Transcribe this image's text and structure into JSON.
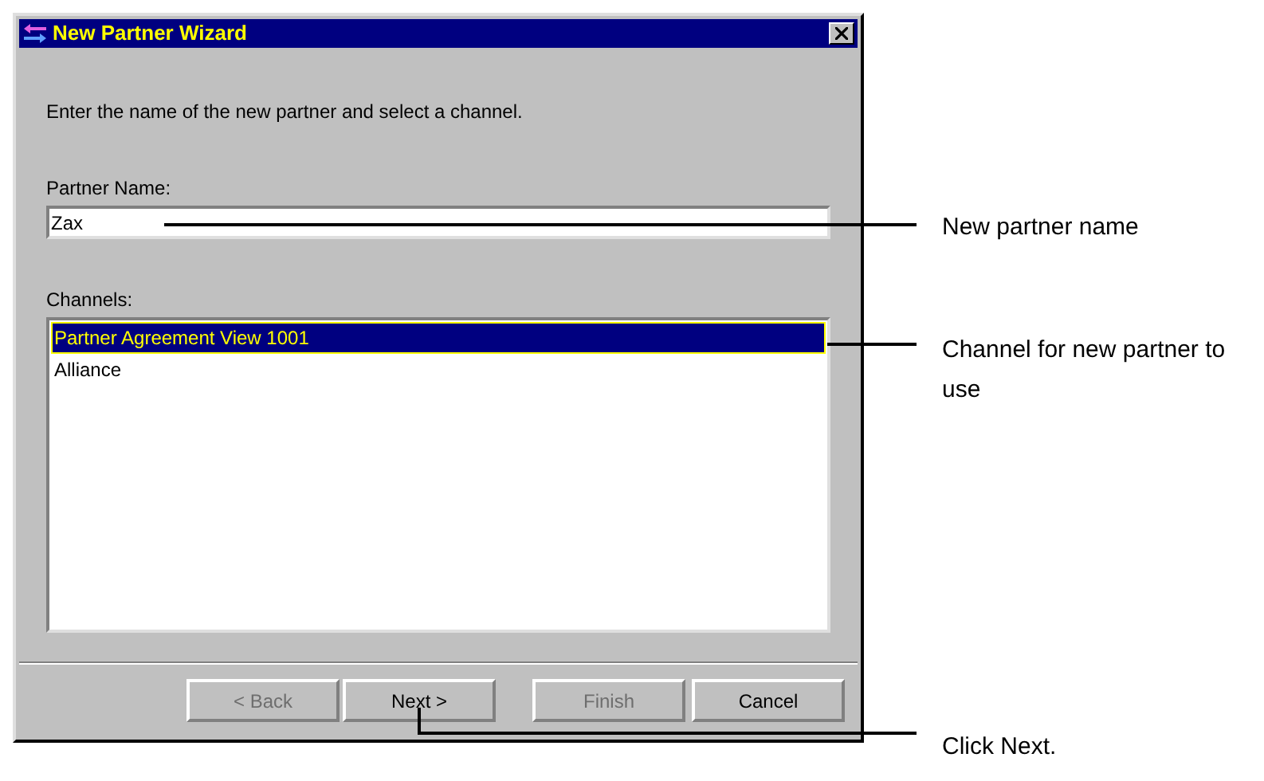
{
  "window": {
    "title": "New Partner Wizard"
  },
  "instruction": "Enter the name of the new partner and select a channel.",
  "partner_name": {
    "label": "Partner Name:",
    "value": "Zax"
  },
  "channels": {
    "label": "Channels:",
    "items": [
      {
        "label": "Partner Agreement View 1001",
        "selected": true
      },
      {
        "label": "Alliance",
        "selected": false
      }
    ]
  },
  "buttons": [
    {
      "label": "< Back",
      "disabled": true
    },
    {
      "label": "Next >",
      "disabled": false
    },
    {
      "label": "Finish",
      "disabled": true
    },
    {
      "label": "Cancel",
      "disabled": false
    }
  ],
  "callouts": [
    {
      "text": "New partner name"
    },
    {
      "text": "Channel for new partner to use"
    },
    {
      "text": "Click Next."
    }
  ]
}
